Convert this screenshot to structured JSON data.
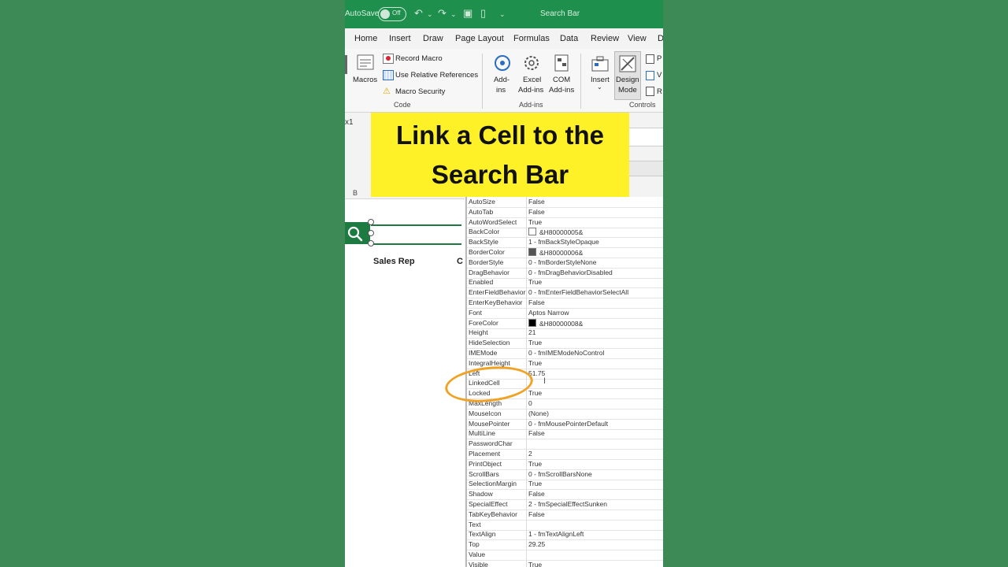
{
  "titlebar": {
    "autosave": "AutoSave",
    "toggle": "Off",
    "filename": "Search Bar"
  },
  "tabs": [
    "Home",
    "Insert",
    "Draw",
    "Page Layout",
    "Formulas",
    "Data",
    "Review",
    "View",
    "D"
  ],
  "ribbon": {
    "macros": "Macros",
    "record_macro": "Record Macro",
    "use_relative": "Use Relative References",
    "macro_security": "Macro Security",
    "code_group": "Code",
    "addins": [
      "Add-",
      "ins"
    ],
    "excel_addins": [
      "Excel",
      "Add-ins"
    ],
    "com_addins": [
      "COM",
      "Add-ins"
    ],
    "addins_group": "Add-ins",
    "insert": "Insert",
    "design_mode": [
      "Design",
      "Mode"
    ],
    "controls_group": "Controls",
    "cut_p": "P",
    "cut_v": "V",
    "cut_r": "R"
  },
  "namebox": "x1",
  "banner": "Link a Cell to the Search Bar",
  "column_b": "B",
  "sheet": {
    "sales_rep": "Sales Rep",
    "col_c": "C"
  },
  "properties": [
    {
      "name": "AutoSize",
      "value": "False"
    },
    {
      "name": "AutoTab",
      "value": "False"
    },
    {
      "name": "AutoWordSelect",
      "value": "True"
    },
    {
      "name": "BackColor",
      "value": "&H80000005&",
      "swatch": "#ffffff"
    },
    {
      "name": "BackStyle",
      "value": "1 - fmBackStyleOpaque"
    },
    {
      "name": "BorderColor",
      "value": "&H80000006&",
      "swatch": "#555555"
    },
    {
      "name": "BorderStyle",
      "value": "0 - fmBorderStyleNone"
    },
    {
      "name": "DragBehavior",
      "value": "0 - fmDragBehaviorDisabled"
    },
    {
      "name": "Enabled",
      "value": "True"
    },
    {
      "name": "EnterFieldBehavior",
      "value": "0 - fmEnterFieldBehaviorSelectAll"
    },
    {
      "name": "EnterKeyBehavior",
      "value": "False"
    },
    {
      "name": "Font",
      "value": "Aptos Narrow"
    },
    {
      "name": "ForeColor",
      "value": "&H80000008&",
      "swatch": "#000000"
    },
    {
      "name": "Height",
      "value": "21"
    },
    {
      "name": "HideSelection",
      "value": "True"
    },
    {
      "name": "IMEMode",
      "value": "0 - fmIMEModeNoControl"
    },
    {
      "name": "IntegralHeight",
      "value": "True"
    },
    {
      "name": "Left",
      "value": "51.75"
    },
    {
      "name": "LinkedCell",
      "value": ""
    },
    {
      "name": "Locked",
      "value": "True"
    },
    {
      "name": "MaxLength",
      "value": "0"
    },
    {
      "name": "MouseIcon",
      "value": "(None)"
    },
    {
      "name": "MousePointer",
      "value": "0 - fmMousePointerDefault"
    },
    {
      "name": "MultiLine",
      "value": "False"
    },
    {
      "name": "PasswordChar",
      "value": ""
    },
    {
      "name": "Placement",
      "value": "2"
    },
    {
      "name": "PrintObject",
      "value": "True"
    },
    {
      "name": "ScrollBars",
      "value": "0 - fmScrollBarsNone"
    },
    {
      "name": "SelectionMargin",
      "value": "True"
    },
    {
      "name": "Shadow",
      "value": "False"
    },
    {
      "name": "SpecialEffect",
      "value": "2 - fmSpecialEffectSunken"
    },
    {
      "name": "TabKeyBehavior",
      "value": "False"
    },
    {
      "name": "Text",
      "value": ""
    },
    {
      "name": "TextAlign",
      "value": "1 - fmTextAlignLeft"
    },
    {
      "name": "Top",
      "value": "29.25"
    },
    {
      "name": "Value",
      "value": ""
    },
    {
      "name": "Visible",
      "value": "True"
    }
  ],
  "colors": {
    "background": "#3e8a57",
    "excel_green": "#1f8f4e",
    "banner": "#fff127",
    "highlight": "#f0a224"
  }
}
